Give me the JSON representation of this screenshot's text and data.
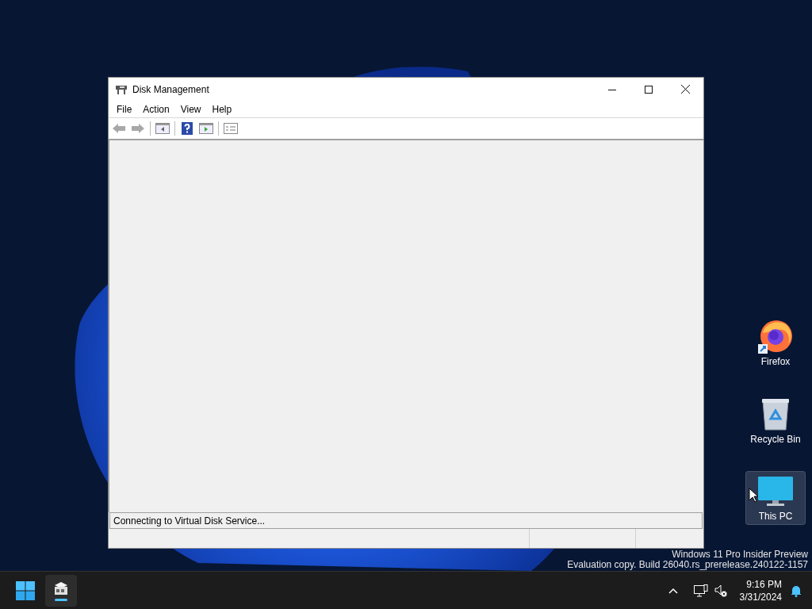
{
  "window": {
    "title": "Disk Management",
    "menu": [
      "File",
      "Action",
      "View",
      "Help"
    ],
    "status": "Connecting to Virtual Disk Service..."
  },
  "desktop_icons": [
    {
      "kind": "firefox",
      "label": "Firefox",
      "selected": false
    },
    {
      "kind": "recycle-bin",
      "label": "Recycle Bin",
      "selected": false
    },
    {
      "kind": "this-pc",
      "label": "This PC",
      "selected": true
    }
  ],
  "watermark": [
    "Windows 11 Pro Insider Preview",
    "Evaluation copy. Build 26040.rs_prerelease.240122-1157"
  ],
  "taskbar": {
    "time": "9:16 PM",
    "date": "3/31/2024"
  }
}
